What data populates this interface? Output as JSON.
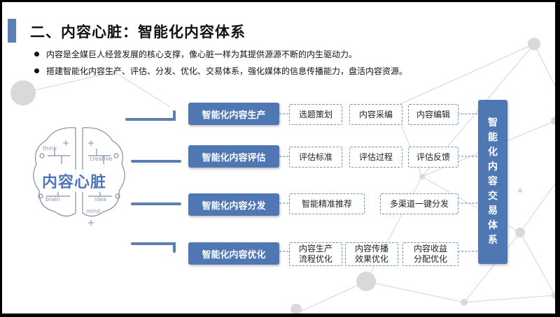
{
  "title": "二、内容心脏：智能化内容体系",
  "bullets": [
    "内容是全媒巨人经营发展的核心支撑，像心脏一样为其提供源源不断的内生驱动力。",
    "搭建智能化内容生产、评估、分发、优化、交易体系，强化媒体的信息传播能力，盘活内容资源。"
  ],
  "brain": {
    "label": "内容心脏",
    "words": [
      "think",
      "creative",
      "brain",
      "idea",
      "mind"
    ]
  },
  "stages": [
    {
      "label": "智能化内容生产",
      "items": [
        "选题策划",
        "内容采编",
        "内容编辑"
      ]
    },
    {
      "label": "智能化内容评估",
      "items": [
        "评估标准",
        "评估过程",
        "评估反馈"
      ]
    },
    {
      "label": "智能化内容分发",
      "items": [
        "智能精准推荐",
        "多渠道一键分发"
      ]
    },
    {
      "label": "智能化内容优化",
      "items": [
        "内容生产\n流程优化",
        "内容传播\n效果优化",
        "内容收益\n分配优化"
      ]
    }
  ],
  "trade_system": [
    "智",
    "能",
    "化",
    "内",
    "容",
    "交",
    "易",
    "体",
    "系"
  ],
  "colors": {
    "accent": "#4e77b4",
    "title_bar": "#5b7fb5",
    "dashed_border": "#6b90c8"
  }
}
